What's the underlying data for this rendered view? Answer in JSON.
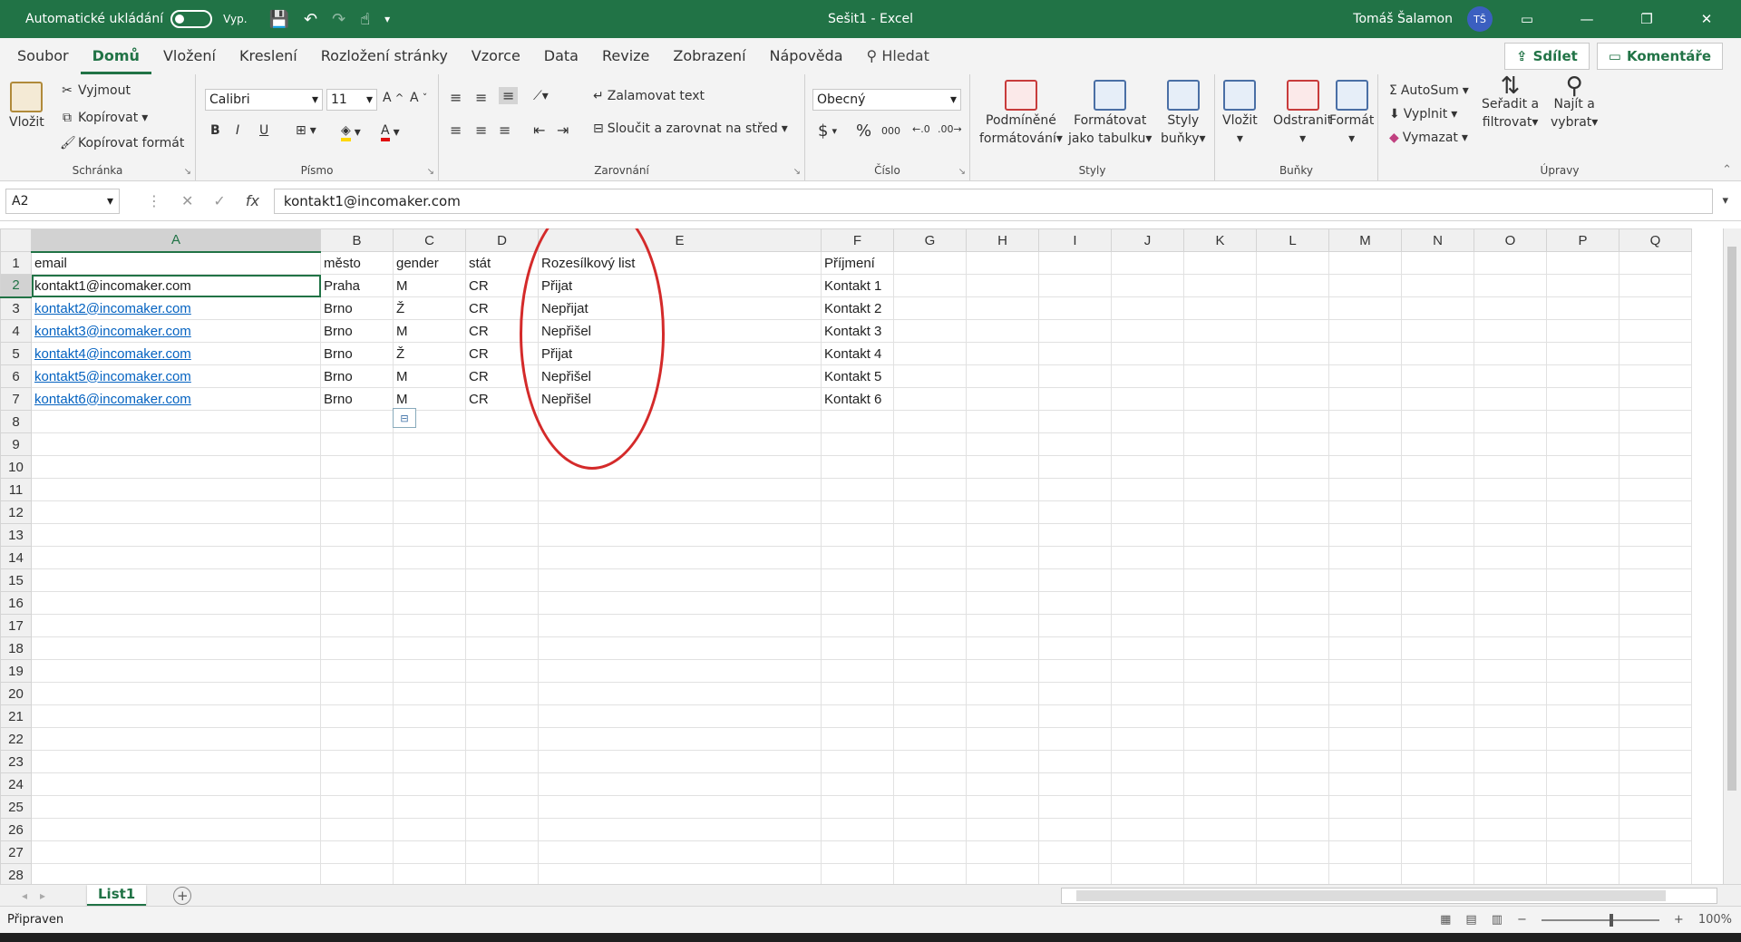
{
  "titlebar": {
    "autosave_label": "Automatické ukládání",
    "autosave_state": "Vyp.",
    "title": "Sešit1 - Excel",
    "user_name": "Tomáš Šalamon",
    "user_initials": "TŠ"
  },
  "tabs": {
    "items": [
      "Soubor",
      "Domů",
      "Vložení",
      "Kreslení",
      "Rozložení stránky",
      "Vzorce",
      "Data",
      "Revize",
      "Zobrazení",
      "Nápověda"
    ],
    "active": "Domů",
    "search_label": "Hledat",
    "share_label": "Sdílet",
    "comments_label": "Komentáře"
  },
  "ribbon": {
    "clipboard": {
      "label": "Schránka",
      "paste": "Vložit",
      "cut": "Vyjmout",
      "copy": "Kopírovat",
      "format_painter": "Kopírovat formát"
    },
    "font": {
      "label": "Písmo",
      "font_name": "Calibri",
      "font_size": "11",
      "bold": "B",
      "italic": "I",
      "underline": "U"
    },
    "alignment": {
      "label": "Zarovnání",
      "wrap": "Zalamovat text",
      "merge": "Sloučit a zarovnat na střed"
    },
    "number": {
      "label": "Číslo",
      "format": "Obecný",
      "thousands": "000"
    },
    "styles": {
      "label": "Styly",
      "conditional": "Podmíněné",
      "conditional2": "formátování",
      "table": "Formátovat",
      "table2": "jako tabulku",
      "cell": "Styly",
      "cell2": "buňky"
    },
    "cells": {
      "label": "Buňky",
      "insert": "Vložit",
      "delete": "Odstranit",
      "format": "Formát"
    },
    "editing": {
      "label": "Úpravy",
      "autosum": "AutoSum",
      "fill": "Vyplnit",
      "clear": "Vymazat",
      "sort": "Seřadit a",
      "sort2": "filtrovat",
      "find": "Najít a",
      "find2": "vybrat"
    }
  },
  "formula_bar": {
    "name_box": "A2",
    "fx": "fx",
    "value": "kontakt1@incomaker.com"
  },
  "grid": {
    "columns": [
      "A",
      "B",
      "C",
      "D",
      "E",
      "F",
      "G",
      "H",
      "I",
      "J",
      "K",
      "L",
      "M",
      "N",
      "O",
      "P",
      "Q"
    ],
    "rows": [
      [
        "email",
        "město",
        "gender",
        "stát",
        "Rozesílkový list",
        "Příjmení"
      ],
      [
        "kontakt1@incomaker.com",
        "Praha",
        "M",
        "CR",
        "Přijat",
        "Kontakt 1"
      ],
      [
        "kontakt2@incomaker.com",
        "Brno",
        "Ž",
        "CR",
        "Nepřijat",
        "Kontakt 2"
      ],
      [
        "kontakt3@incomaker.com",
        "Brno",
        "M",
        "CR",
        "Nepřišel",
        "Kontakt 3"
      ],
      [
        "kontakt4@incomaker.com",
        "Brno",
        "Ž",
        "CR",
        "Přijat",
        "Kontakt 4"
      ],
      [
        "kontakt5@incomaker.com",
        "Brno",
        "M",
        "CR",
        "Nepřišel",
        "Kontakt 5"
      ],
      [
        "kontakt6@incomaker.com",
        "Brno",
        "M",
        "CR",
        "Nepřišel",
        "Kontakt 6"
      ]
    ],
    "row_count": 29,
    "selected_cell": "A2"
  },
  "sheets": {
    "tabs": [
      "List1"
    ],
    "active": "List1"
  },
  "status": {
    "ready": "Připraven",
    "zoom": "100%"
  },
  "colors": {
    "brand": "#217346",
    "link": "#0563c1",
    "annotation": "#d42a2a"
  }
}
